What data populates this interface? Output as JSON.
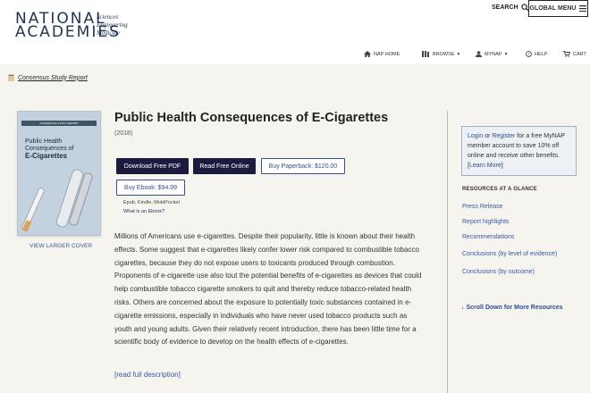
{
  "header": {
    "logo_line1": "NATIONAL",
    "logo_line2": "ACADEMIES",
    "logo_sub": [
      "Sciences",
      "Engineering",
      "Medicine"
    ],
    "search_label": "SEARCH",
    "global_menu_label": "GLOBAL MENU"
  },
  "nav": {
    "nap_home": "NAP HOME",
    "browse": "BROWSE",
    "mynap": "MYNAP",
    "help": "HELP",
    "cart": "CART"
  },
  "badge": "Consensus Study Report",
  "cover": {
    "band_text": "CONSENSUS STUDY REPORT",
    "title_line1": "Public Health",
    "title_line2": "Consequences of",
    "title_line3": "E-Cigarettes",
    "view_larger": "VIEW LARGER COVER"
  },
  "book": {
    "title": "Public Health Consequences of E-Cigarettes",
    "year": "(2018)",
    "btn_pdf": "Download Free PDF",
    "btn_online": "Read Free Online",
    "btn_paperback": "Buy Paperback: $120.00",
    "btn_ebook": "Buy Ebook: $94.99",
    "formats": "Epub, Kindle, MobiPocket",
    "what_ebook": "What is an Ebook?",
    "description": "Millions of Americans use e-cigarettes. Despite their popularity, little is known about their health effects. Some suggest that e-cigarettes likely confer lower risk compared to combustible tobacco cigarettes, because they do not expose users to toxicants produced through combustion. Proponents of e-cigarette use also tout the potential benefits of e-cigarettes as devices that could help combustible tobacco cigarette smokers to quit and thereby reduce tobacco-related health risks. Others are concerned about the exposure to potentially toxic substances contained in e-cigarette emissions, especially in individuals who have never used tobacco products such as youth and young adults. Given their relatively recent introduction, there has been little time for a scientific body of evidence to develop on the health effects of e-cigarettes.",
    "read_full": "[read full description]"
  },
  "sidebar": {
    "login": "Login",
    "or": " or ",
    "register": "Register",
    "login_text": " for a free MyNAP member account to save 10% off online and receive other benefits. [",
    "learn_more": "Learn More",
    "close_bracket": "]",
    "resources_heading": "RESOURCES AT A GLANCE",
    "resources": [
      "Press Release",
      "Report highlights",
      "Recommendations",
      "Conclusions (by level of evidence)",
      "Conclusions (by outcome)"
    ],
    "scroll_down": "↓ Scroll Down for More Resources"
  }
}
